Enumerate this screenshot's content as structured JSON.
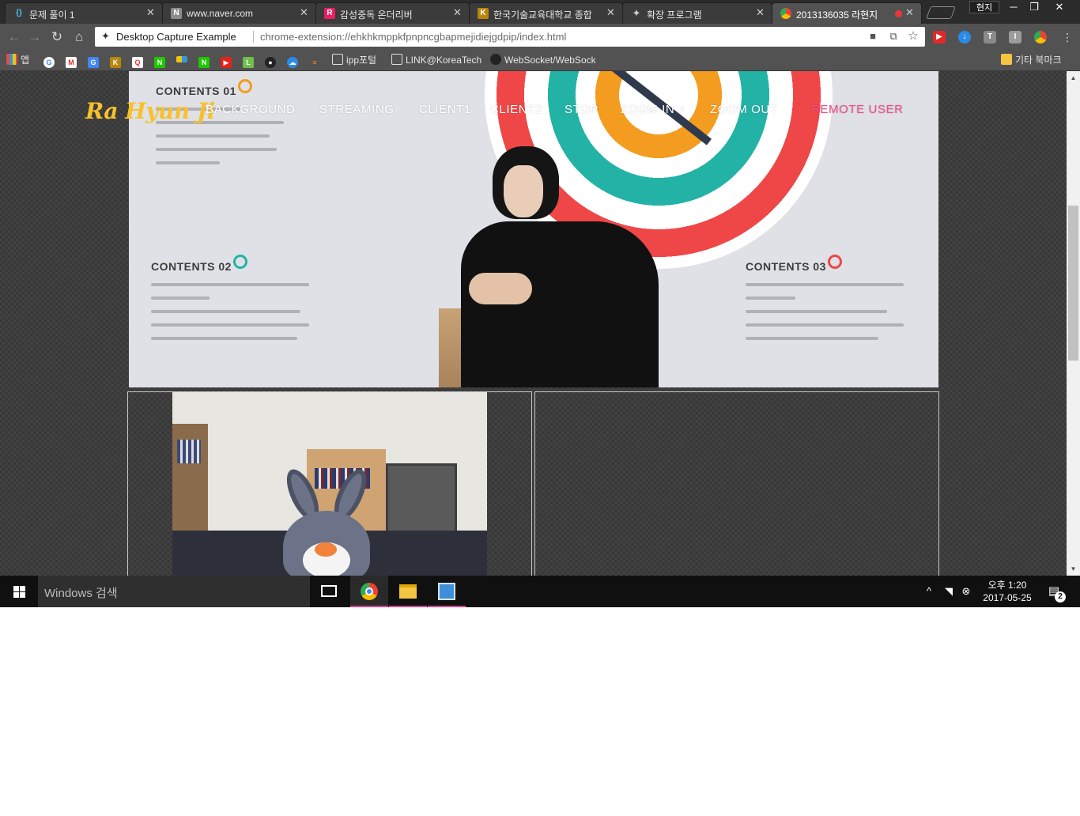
{
  "browser": {
    "tabs": [
      {
        "title": "문제 풀이 1",
        "favicon": "{}"
      },
      {
        "title": "www.naver.com",
        "favicon": "N"
      },
      {
        "title": "감성중독 온더리버",
        "favicon": "R"
      },
      {
        "title": "한국기술교육대학교 종합",
        "favicon": "K"
      },
      {
        "title": "확장 프로그램",
        "favicon": "puzzle"
      },
      {
        "title": "2013136035 라현지",
        "favicon": "chrome",
        "active": true
      }
    ],
    "profile_label": "현지",
    "window_controls": {
      "minimize": "─",
      "restore": "❐",
      "close": "✕"
    }
  },
  "toolbar": {
    "extension_name": "Desktop Capture Example",
    "url": "chrome-extension://ehkhkmppkfpnpncgbapmejidiejgdpip/index.html"
  },
  "bookmarks": {
    "apps_label": "앱",
    "items": [
      "ipp포털",
      "LINK@KoreaTech",
      "WebSocket/WebSock"
    ],
    "other_label": "기타 북마크"
  },
  "site": {
    "brand": "Ra Hyun Ji",
    "nav": [
      "BACKGROUND",
      "STREAMING",
      "CLIENT1",
      "CLIENT2",
      "STOP",
      "ZOOM IN +",
      "ZOOM OUT",
      "REMOTE USER"
    ]
  },
  "slide": {
    "contents_01": "CONTENTS 01",
    "contents_02": "CONTENTS 02",
    "contents_03": "CONTENTS 03"
  },
  "taskbar": {
    "search_placeholder": "Windows 검색",
    "time": "오후 1:20",
    "date": "2017-05-25",
    "notifications": "2"
  },
  "colors": {
    "brand": "#f7c12d",
    "accent_nav": "#f44a87",
    "target_red": "#ef4747",
    "target_teal": "#23b3a6",
    "target_orange": "#f39c1f"
  }
}
